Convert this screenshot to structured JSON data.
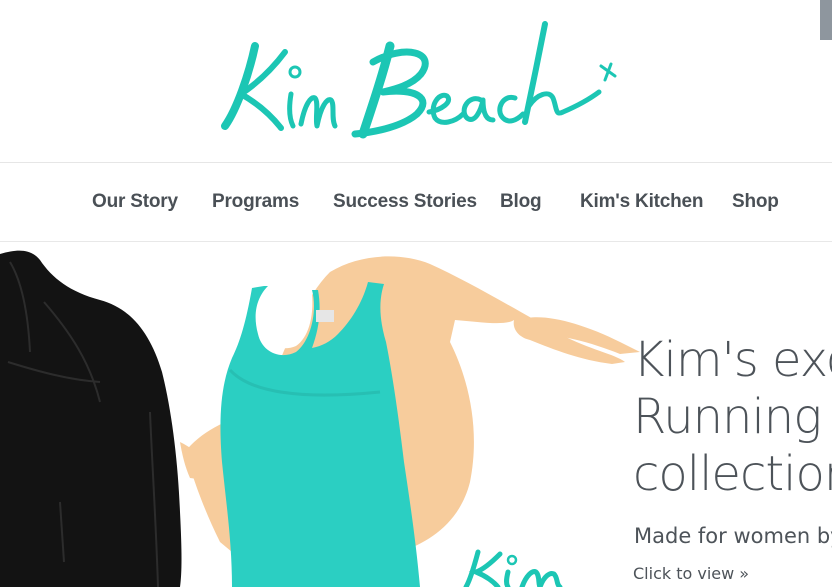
{
  "brand": {
    "logo_text": "Kim Beach",
    "accent_color": "#1cc6b4"
  },
  "nav": {
    "items": [
      {
        "label": "Our Story"
      },
      {
        "label": "Programs"
      },
      {
        "label": "Success Stories"
      },
      {
        "label": "Blog"
      },
      {
        "label": "Kim's Kitchen"
      },
      {
        "label": "Shop"
      }
    ]
  },
  "hero": {
    "headline_lines": [
      "Kim's exc",
      "Running",
      "collection"
    ],
    "subtitle": "Made for women by",
    "cta": "Click to view »",
    "brush_color": "#f7cc9c",
    "tank_color": "#2bcfc2",
    "jacket_color": "#131313",
    "watermark_text": "Kim"
  }
}
